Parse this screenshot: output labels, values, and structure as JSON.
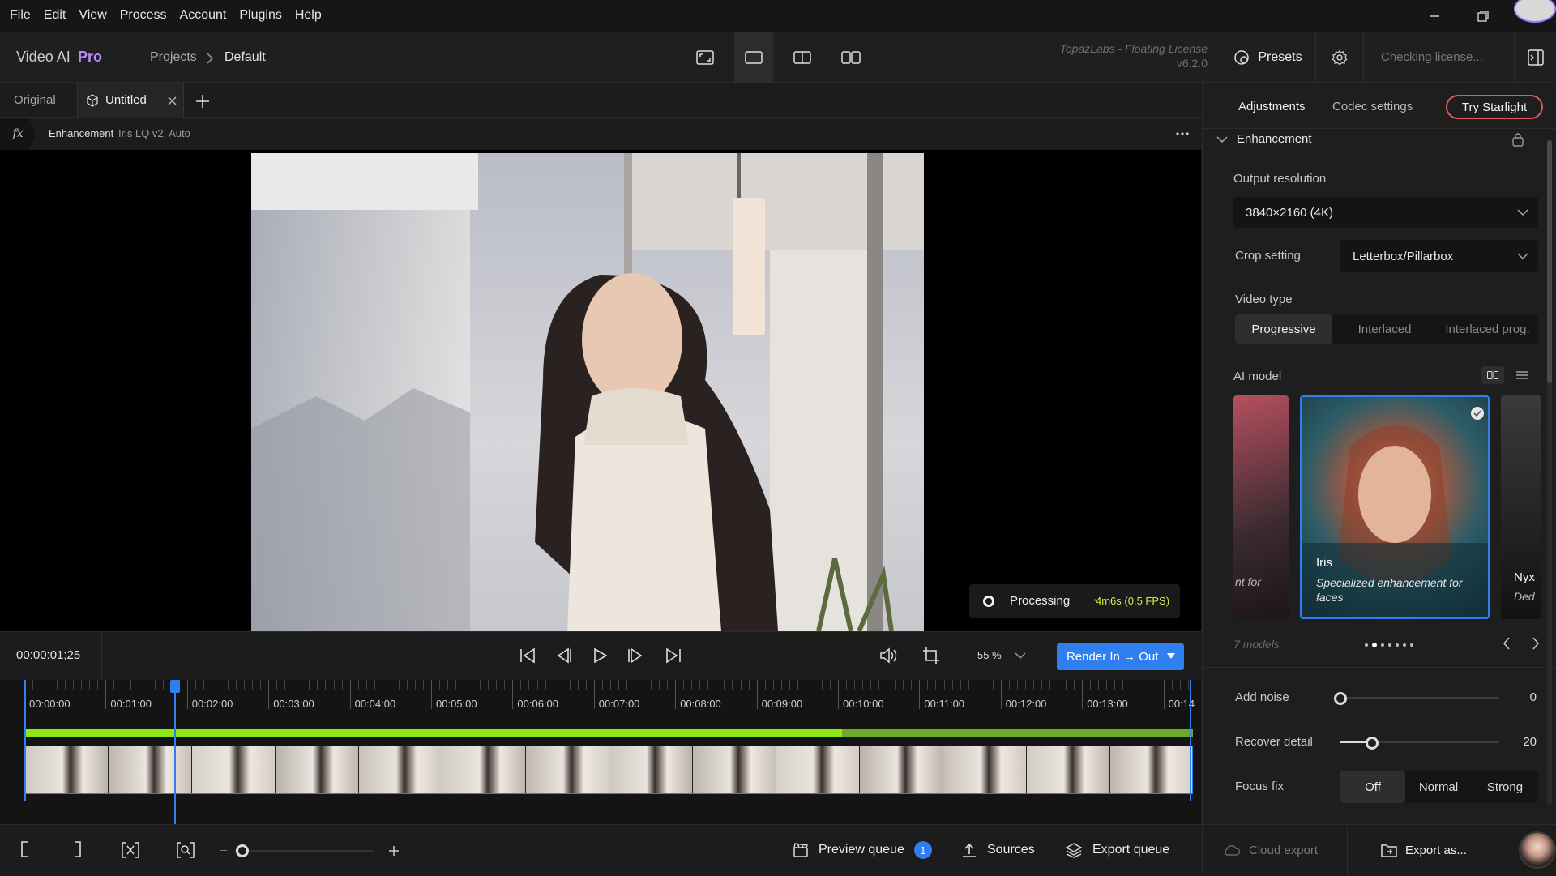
{
  "menubar": {
    "items": [
      "File",
      "Edit",
      "View",
      "Process",
      "Account",
      "Plugins",
      "Help"
    ]
  },
  "header": {
    "app_name": "Video AI",
    "app_edition": "Pro",
    "breadcrumb": [
      "Projects",
      "Default"
    ],
    "license_line1": "TopazLabs - Floating License",
    "license_line2": "v6.2.0",
    "presets_label": "Presets",
    "license_status": "Checking license..."
  },
  "tabs": {
    "original": "Original",
    "untitled": "Untitled"
  },
  "enhancement_bar": {
    "label": "Enhancement",
    "detail": "Iris LQ v2, Auto"
  },
  "viewer": {
    "processing_label": "Processing",
    "processing_time": "4m6s (0.5 FPS)"
  },
  "transport": {
    "timecode": "00:00:01;25",
    "zoom": "55 %",
    "render_button": "Render In → Out"
  },
  "timeline": {
    "ticks": [
      "00:00:00",
      "00:01:00",
      "00:02:00",
      "00:03:00",
      "00:04:00",
      "00:05:00",
      "00:06:00",
      "00:07:00",
      "00:08:00",
      "00:09:00",
      "00:10:00",
      "00:11:00",
      "00:12:00",
      "00:13:00",
      "00:14"
    ],
    "processed_fraction": 0.7,
    "playhead_fraction": 0.128
  },
  "bottombar": {
    "preview_queue": "Preview queue",
    "preview_count": "1",
    "sources": "Sources",
    "export_queue": "Export queue"
  },
  "rightpanel": {
    "tabs": [
      "Adjustments",
      "Codec settings"
    ],
    "try_button": "Try Starlight",
    "section": "Enhancement",
    "output_resolution_label": "Output resolution",
    "output_resolution": "3840×2160 (4K)",
    "crop_label": "Crop setting",
    "crop_value": "Letterbox/Pillarbox",
    "video_type_label": "Video type",
    "video_types": [
      "Progressive",
      "Interlaced",
      "Interlaced prog."
    ],
    "ai_model_label": "AI model",
    "model_left_caption": "nt for",
    "model_name": "Iris",
    "model_desc": "Specialized enhancement for faces",
    "model_right_name": "Nyx",
    "model_right_caption": "Ded",
    "models_count": "7 models",
    "add_noise_label": "Add noise",
    "add_noise_value": "0",
    "recover_detail_label": "Recover detail",
    "recover_detail_value": "20",
    "focus_fix_label": "Focus fix",
    "focus_fix_options": [
      "Off",
      "Normal",
      "Strong"
    ]
  },
  "rightbottom": {
    "cloud_export": "Cloud export",
    "export_as": "Export as..."
  },
  "colors": {
    "accent_blue": "#2f7ff0",
    "processed_green": "#8fe81a",
    "edition_purple": "#b98cff",
    "starlight_red": "#e0585a"
  }
}
